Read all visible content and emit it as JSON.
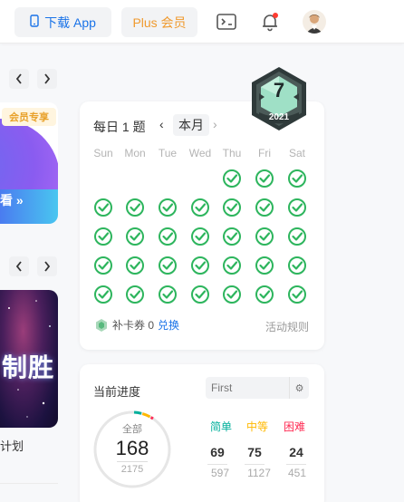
{
  "topbar": {
    "download_label": "下载 App",
    "plus_label": "Plus 会员",
    "icons": [
      "phone-icon",
      "add-frame-icon",
      "bell-icon",
      "avatar"
    ]
  },
  "left_panel": {
    "promo_badge": "会员专享",
    "promo_button": "看 »",
    "poster_text": "制胜",
    "poster_caption": "计划"
  },
  "calendar": {
    "title": "每日 1 题",
    "prev": "‹",
    "month": "本月",
    "next": "›",
    "weekdays": [
      "Sun",
      "Mon",
      "Tue",
      "Wed",
      "Thu",
      "Fri",
      "Sat"
    ],
    "coupon_label": "补卡券 0",
    "redeem_label": "兑换",
    "rules_label": "活动规则",
    "check_color": "#2db55d"
  },
  "medal": {
    "number": "7",
    "year": "2021"
  },
  "progress": {
    "title": "当前进度",
    "select_value": "First",
    "gear": "⚙",
    "all_label": "全部",
    "solved": "168",
    "total": "2175",
    "difficulties": [
      {
        "label": "简单",
        "solved": "69",
        "total": "597",
        "color": "#00af9b"
      },
      {
        "label": "中等",
        "solved": "75",
        "total": "1127",
        "color": "#ffb800"
      },
      {
        "label": "困难",
        "solved": "24",
        "total": "451",
        "color": "#ff2d55"
      }
    ]
  }
}
